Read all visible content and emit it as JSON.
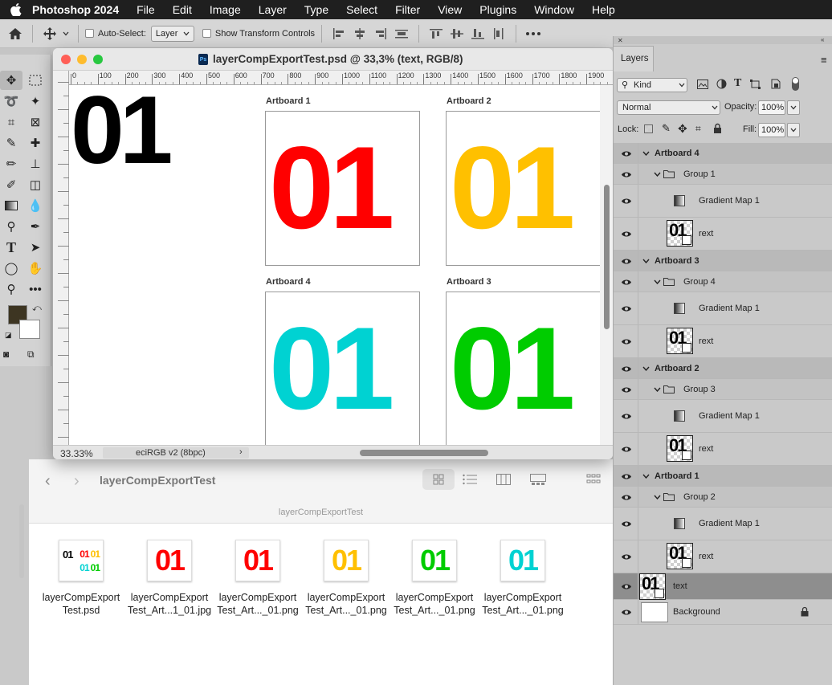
{
  "menubar": {
    "app_name": "Photoshop 2024",
    "items": [
      "File",
      "Edit",
      "Image",
      "Layer",
      "Type",
      "Select",
      "Filter",
      "View",
      "Plugins",
      "Window",
      "Help"
    ]
  },
  "options_bar": {
    "auto_select_label": "Auto-Select:",
    "auto_select_value": "Layer",
    "show_transform_label": "Show Transform Controls"
  },
  "document": {
    "title": "layerCompExportTest.psd @ 33,3% (text, RGB/8)",
    "ruler_ticks": [
      "0",
      "100",
      "200",
      "300",
      "400",
      "500",
      "600",
      "700",
      "800",
      "900",
      "1000",
      "1100",
      "1200",
      "1300",
      "1400",
      "1500",
      "1600",
      "1700",
      "1800",
      "1900"
    ],
    "zoom": "33.33%",
    "color_profile": "eciRGB v2 (8bpc)",
    "main_text": "01",
    "artboards": [
      {
        "label": "Artboard 1",
        "text": "01",
        "color": "#ff0000"
      },
      {
        "label": "Artboard 2",
        "text": "01",
        "color": "#ffc000"
      },
      {
        "label": "Artboard 4",
        "text": "01",
        "color": "#00d2d2"
      },
      {
        "label": "Artboard 3",
        "text": "01",
        "color": "#00cc00"
      }
    ]
  },
  "finder": {
    "title": "layerCompExportTest",
    "path_title": "layerCompExportTest",
    "files": [
      {
        "line1": "layerCompExport",
        "line2": "Test.psd",
        "thumb": "psd"
      },
      {
        "line1": "layerCompExport",
        "line2": "Test_Art...1_01.jpg",
        "thumb": "#ff0000"
      },
      {
        "line1": "layerCompExport",
        "line2": "Test_Art..._01.png",
        "thumb": "#ff0000"
      },
      {
        "line1": "layerCompExport",
        "line2": "Test_Art..._01.png",
        "thumb": "#ffc000"
      },
      {
        "line1": "layerCompExport",
        "line2": "Test_Art..._01.png",
        "thumb": "#00cc00"
      },
      {
        "line1": "layerCompExport",
        "line2": "Test_Art..._01.png",
        "thumb": "#00d2d2"
      }
    ],
    "psd_thumb_text": "01"
  },
  "layers_panel": {
    "tab": "Layers",
    "filter_kind": "Kind",
    "blend_mode": "Normal",
    "opacity_label": "Opacity:",
    "opacity_value": "100%",
    "lock_label": "Lock:",
    "fill_label": "Fill:",
    "fill_value": "100%",
    "thumb_text": "01",
    "artboards": [
      {
        "name": "Artboard 4",
        "group": "Group 1",
        "adjust": "Gradient Map 1",
        "text_layer": "rext"
      },
      {
        "name": "Artboard 3",
        "group": "Group 4",
        "adjust": "Gradient Map 1",
        "text_layer": "rext"
      },
      {
        "name": "Artboard 2",
        "group": "Group 3",
        "adjust": "Gradient Map 1",
        "text_layer": "rext"
      },
      {
        "name": "Artboard 1",
        "group": "Group 2",
        "adjust": "Gradient Map 1",
        "text_layer": "rext"
      }
    ],
    "text_layer": "text",
    "background_layer": "Background"
  }
}
